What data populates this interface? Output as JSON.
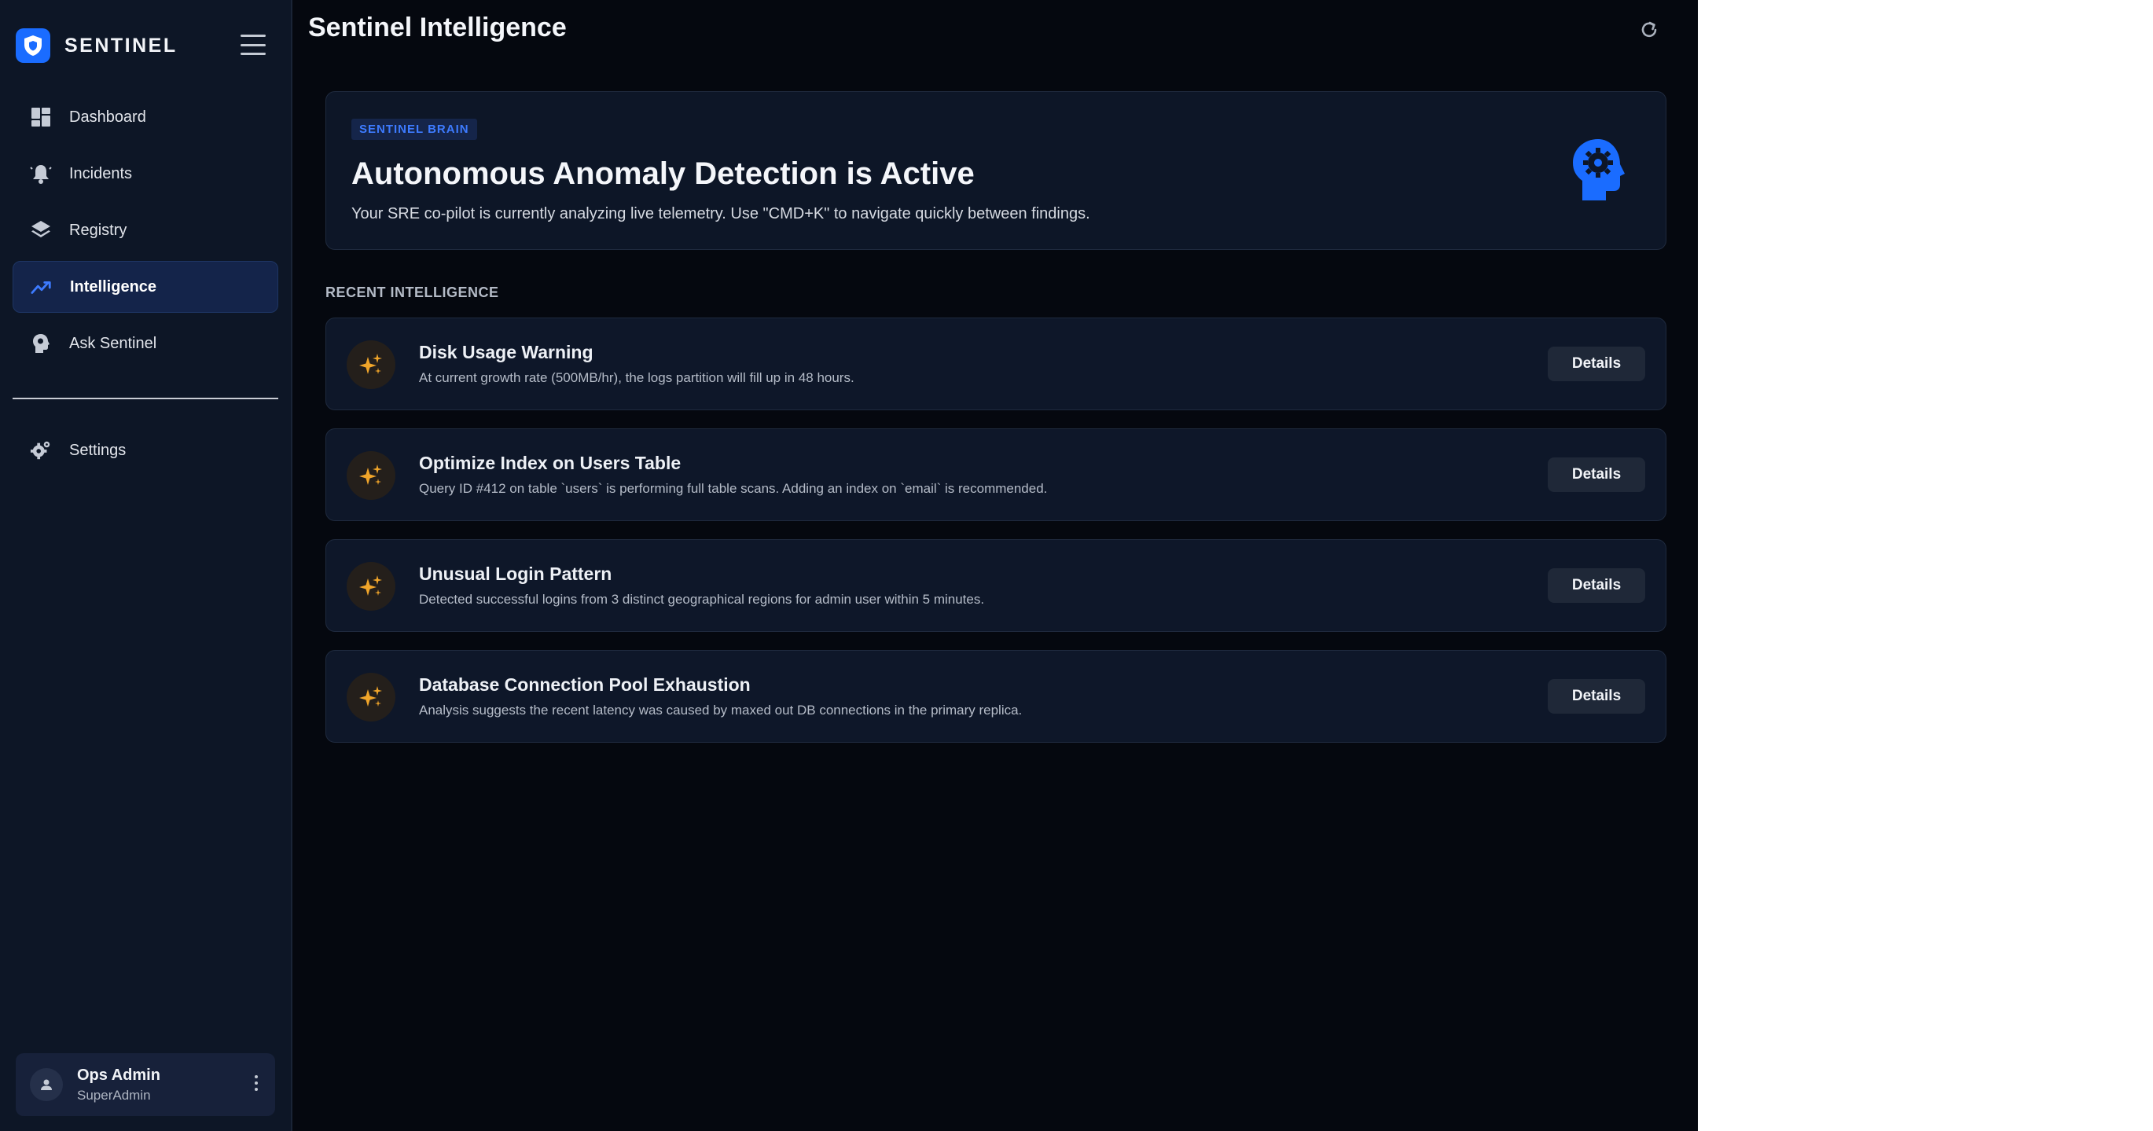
{
  "brand": {
    "name": "SENTINEL"
  },
  "sidebar": {
    "items": [
      {
        "label": "Dashboard",
        "icon": "dashboard-icon"
      },
      {
        "label": "Incidents",
        "icon": "bell-icon"
      },
      {
        "label": "Registry",
        "icon": "layers-icon"
      },
      {
        "label": "Intelligence",
        "icon": "trending-icon",
        "active": true
      },
      {
        "label": "Ask Sentinel",
        "icon": "brain-head-icon"
      }
    ],
    "settings": {
      "label": "Settings",
      "icon": "gear-icon"
    }
  },
  "user": {
    "name": "Ops Admin",
    "role": "SuperAdmin"
  },
  "page": {
    "title": "Sentinel Intelligence"
  },
  "hero": {
    "badge": "SENTINEL BRAIN",
    "title": "Autonomous Anomaly Detection is Active",
    "subtitle": "Your SRE co-pilot is currently analyzing live telemetry. Use \"CMD+K\" to navigate quickly between findings."
  },
  "section": {
    "label": "RECENT INTELLIGENCE"
  },
  "insights": [
    {
      "title": "Disk Usage Warning",
      "description": "At current growth rate (500MB/hr), the logs partition will fill up in 48 hours.",
      "action": "Details"
    },
    {
      "title": "Optimize Index on Users Table",
      "description": "Query ID #412 on table `users` is performing full table scans. Adding an index on `email` is recommended.",
      "action": "Details"
    },
    {
      "title": "Unusual Login Pattern",
      "description": "Detected successful logins from 3 distinct geographical regions for admin user within 5 minutes.",
      "action": "Details"
    },
    {
      "title": "Database Connection Pool Exhaustion",
      "description": "Analysis suggests the recent latency was caused by maxed out DB connections in the primary replica.",
      "action": "Details"
    }
  ],
  "colors": {
    "accent": "#1a6cff",
    "sparkle": "#f0a52a",
    "background": "#05080f",
    "sidebar": "#0d1626"
  }
}
